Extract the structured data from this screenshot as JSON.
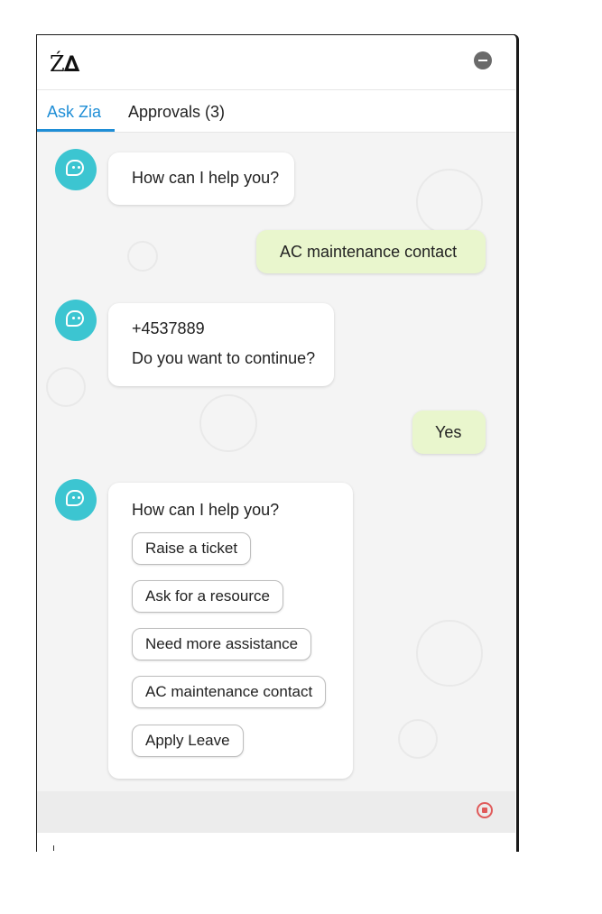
{
  "header": {
    "logo_text": "ZIA",
    "minimize_icon": "minus-circle-icon"
  },
  "tabs": [
    {
      "label": "Ask Zia",
      "active": true
    },
    {
      "label": "Approvals (3)",
      "active": false
    }
  ],
  "messages": [
    {
      "sender": "bot",
      "lines": [
        "How can I help you?"
      ]
    },
    {
      "sender": "user",
      "lines": [
        "AC maintenance contact"
      ]
    },
    {
      "sender": "bot",
      "lines": [
        "+4537889",
        "Do you want to continue?"
      ]
    },
    {
      "sender": "user",
      "lines": [
        "Yes"
      ]
    },
    {
      "sender": "bot",
      "lines": [
        "How can I help you?"
      ],
      "options": [
        "Raise a ticket",
        "Ask for a resource",
        "Need more assistance",
        "AC maintenance contact",
        "Apply Leave"
      ]
    }
  ],
  "footer": {
    "stop_icon": "stop-record-icon"
  },
  "colors": {
    "accent": "#1f8ed6",
    "bot_avatar": "#3cc5d1",
    "user_bubble": "#e9f6cd",
    "stop": "#e05a5a"
  }
}
